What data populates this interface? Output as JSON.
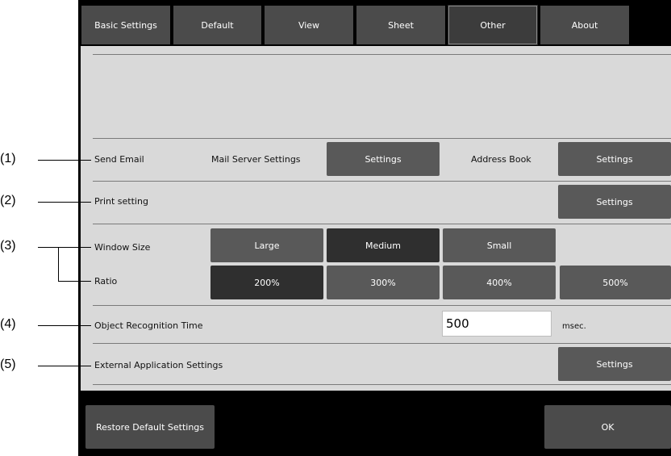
{
  "tabs": [
    "Basic Settings",
    "Default",
    "View",
    "Sheet",
    "Other",
    "About"
  ],
  "send_email": {
    "label": "Send Email",
    "mail_server_label": "Mail Server Settings",
    "mail_server_button": "Settings",
    "address_book_label": "Address Book",
    "address_book_button": "Settings"
  },
  "print": {
    "label": "Print setting",
    "button": "Settings"
  },
  "window_size": {
    "label": "Window Size",
    "options": [
      "Large",
      "Medium",
      "Small"
    ],
    "selected": "Medium"
  },
  "ratio": {
    "label": "Ratio",
    "options": [
      "200%",
      "300%",
      "400%",
      "500%"
    ],
    "selected": "200%"
  },
  "object_recognition": {
    "label": "Object Recognition Time",
    "value": "500",
    "unit": "msec."
  },
  "external_app": {
    "label": "External Application Settings",
    "button": "Settings"
  },
  "footer": {
    "restore_label": "Restore Default Settings",
    "ok_label": "OK"
  },
  "callouts": [
    "(1)",
    "(2)",
    "(3)",
    "(4)",
    "(5)"
  ]
}
